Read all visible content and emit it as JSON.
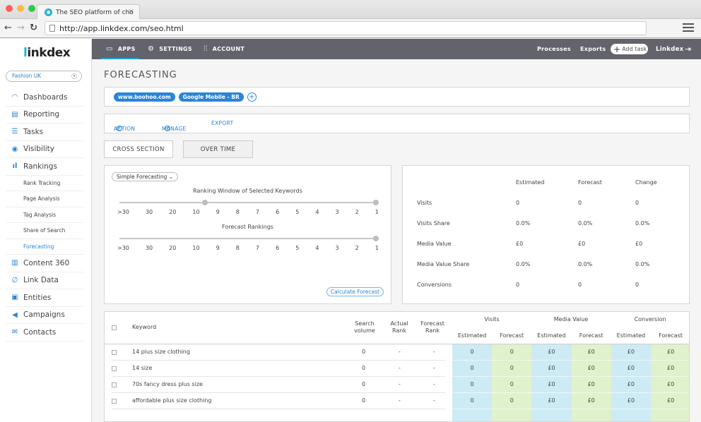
{
  "browser": {
    "tab_title": "The SEO platform of cho",
    "url": "http://app.linkdex.com/seo.html"
  },
  "sidebar": {
    "logo": "linkdex",
    "account": "Fashion UK",
    "items": [
      {
        "label": "Dashboards",
        "icon": "dashboard-icon"
      },
      {
        "label": "Reporting",
        "icon": "document-icon"
      },
      {
        "label": "Tasks",
        "icon": "clipboard-icon"
      },
      {
        "label": "Visibility",
        "icon": "eye-icon"
      },
      {
        "label": "Rankings",
        "icon": "bar-chart-icon"
      }
    ],
    "sub_items": [
      {
        "label": "Rank Tracking"
      },
      {
        "label": "Page Analysis"
      },
      {
        "label": "Tag Analysis"
      },
      {
        "label": "Share of Search"
      },
      {
        "label": "Forecasting",
        "active": true
      }
    ],
    "items_after": [
      {
        "label": "Content 360",
        "icon": "book-icon"
      },
      {
        "label": "Link Data",
        "icon": "link-icon"
      },
      {
        "label": "Entities",
        "icon": "entity-icon"
      },
      {
        "label": "Campaigns",
        "icon": "megaphone-icon"
      },
      {
        "label": "Contacts",
        "icon": "envelope-icon"
      }
    ]
  },
  "appbar": {
    "apps": "APPS",
    "settings": "SETTINGS",
    "account": "ACCOUNT",
    "processes": "Processes",
    "exports": "Exports",
    "add_task": "Add task",
    "user": "Linkdex"
  },
  "page": {
    "title": "FORECASTING",
    "chips": [
      "www.boohoo.com",
      "Google Mobile - BR"
    ],
    "actions": {
      "action": "ACTION",
      "manage": "MANAGE",
      "export": "EXPORT"
    },
    "view_buttons": {
      "cross_section": "CROSS SECTION",
      "over_time": "OVER TIME"
    }
  },
  "forecast_controls": {
    "mode": "Simple Forecasting",
    "ranking_window_title": "Ranking Window of Selected Keywords",
    "forecast_rankings_title": "Forecast Rankings",
    "tick_labels": [
      ">30",
      "30",
      "20",
      "10",
      "9",
      "8",
      "7",
      "6",
      "5",
      "4",
      "3",
      "2",
      "1"
    ],
    "ranking_window_range": [
      "9",
      "1"
    ],
    "forecast_ranking_value": "1",
    "calculate_button": "Calculate Forecast"
  },
  "summary": {
    "columns": [
      "Estimated",
      "Forecast",
      "Change"
    ],
    "rows": [
      {
        "label": "Visits",
        "values": [
          "0",
          "0",
          "0"
        ]
      },
      {
        "label": "Visits Share",
        "values": [
          "0.0%",
          "0.0%",
          "0.0%"
        ]
      },
      {
        "label": "Media Value",
        "values": [
          "£0",
          "£0",
          "£0"
        ]
      },
      {
        "label": "Media Value Share",
        "values": [
          "0.0%",
          "0.0%",
          "0.0%"
        ]
      },
      {
        "label": "Conversions",
        "values": [
          "0",
          "0",
          "0"
        ]
      }
    ]
  },
  "keywords_table": {
    "headers": {
      "keyword": "Keyword",
      "search_volume": "Search volume",
      "actual_rank": "Actual Rank",
      "forecast_rank": "Forecast Rank",
      "groups": [
        "Visits",
        "Media Value",
        "Conversion"
      ],
      "sub": [
        "Estimated",
        "Forecast",
        "Estimated",
        "Forecast",
        "Estimated",
        "Forecast"
      ]
    },
    "rows": [
      {
        "keyword": "14 plus size clothing",
        "search_volume": "0",
        "actual_rank": "-",
        "forecast_rank": "-",
        "values": [
          "0",
          "0",
          "£0",
          "£0",
          "£0",
          "£0"
        ]
      },
      {
        "keyword": "14 size",
        "search_volume": "0",
        "actual_rank": "-",
        "forecast_rank": "-",
        "values": [
          "0",
          "0",
          "£0",
          "£0",
          "£0",
          "£0"
        ]
      },
      {
        "keyword": "70s fancy dress plus size",
        "search_volume": "0",
        "actual_rank": "-",
        "forecast_rank": "-",
        "values": [
          "0",
          "0",
          "£0",
          "£0",
          "£0",
          "£0"
        ]
      },
      {
        "keyword": "affordable plus size clothing",
        "search_volume": "0",
        "actual_rank": "-",
        "forecast_rank": "-",
        "values": [
          "0",
          "0",
          "£0",
          "£0",
          "£0",
          "£0"
        ]
      }
    ]
  },
  "colors": {
    "accent": "#2a84d8",
    "appbar": "#62636b",
    "estimated_col": "#cdebf5",
    "forecast_col": "#dff2cc"
  }
}
